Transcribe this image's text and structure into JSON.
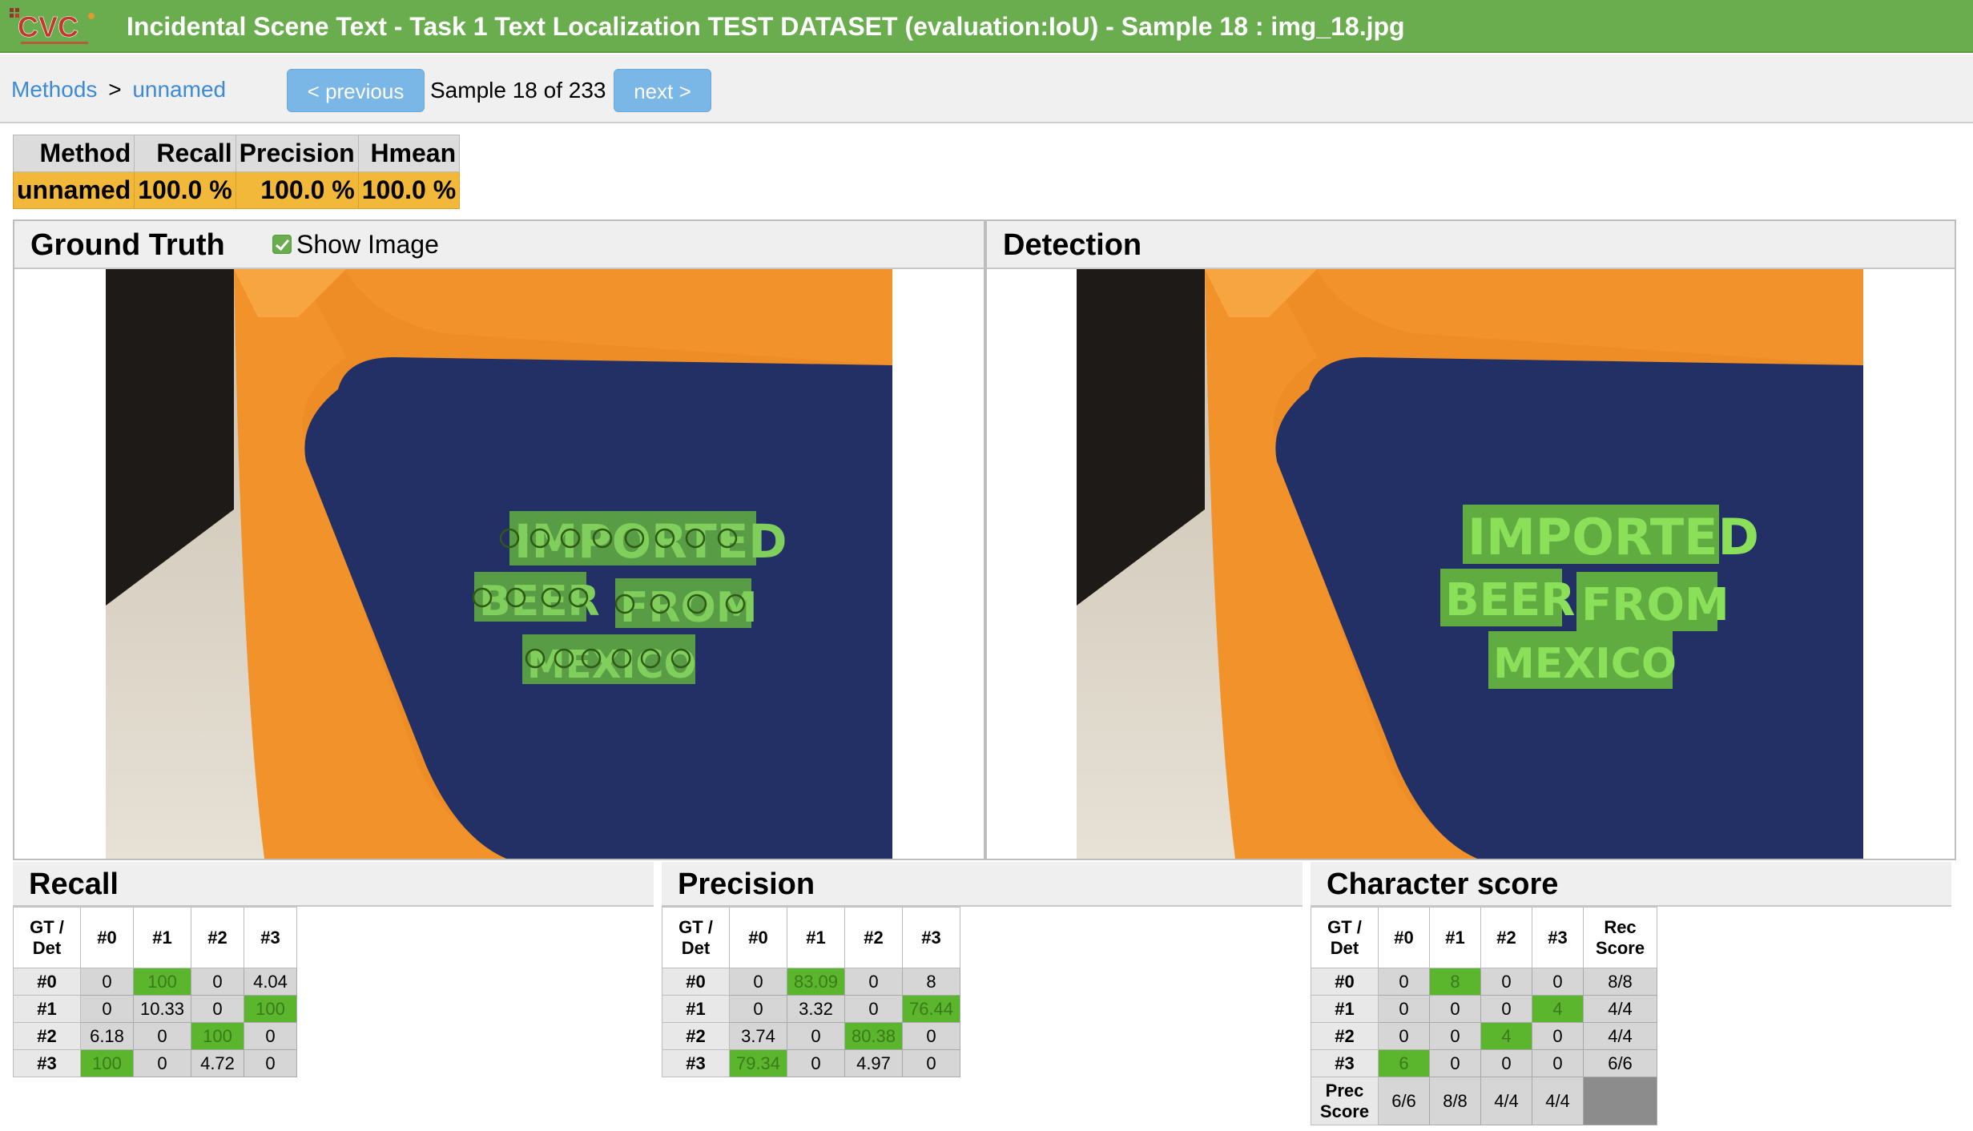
{
  "header": {
    "logo_text": "CVC",
    "title": "Incidental Scene Text - Task 1 Text Localization TEST DATASET (evaluation:IoU) - Sample 18 : img_18.jpg",
    "colors": {
      "bar": "#6aad4f",
      "button": "#7ab6e6",
      "link": "#3d8bd7",
      "highlight": "#f2b83a",
      "match": "#5bb52d"
    }
  },
  "nav": {
    "methods_label": "Methods",
    "separator": ">",
    "method_name": "unnamed",
    "previous_label": "< previous",
    "sample_text": "Sample 18 of 233",
    "next_label": "next >"
  },
  "summary": {
    "headers": [
      "Method",
      "Recall",
      "Precision",
      "Hmean"
    ],
    "row": [
      "unnamed",
      "100.0 %",
      "100.0 %",
      "100.0 %"
    ]
  },
  "panels": {
    "gt_title": "Ground Truth",
    "show_image_label": "Show Image",
    "show_image_checked": true,
    "det_title": "Detection",
    "scene_words": [
      "IMPORTED",
      "BEER",
      "FROM",
      "MEXICO"
    ]
  },
  "recall": {
    "title": "Recall",
    "corner_line1": "GT /",
    "corner_line2": "Det",
    "cols": [
      "#0",
      "#1",
      "#2",
      "#3"
    ],
    "rows": [
      {
        "label": "#0",
        "cells": [
          "0",
          "100",
          "0",
          "4.04"
        ]
      },
      {
        "label": "#1",
        "cells": [
          "0",
          "10.33",
          "0",
          "100"
        ]
      },
      {
        "label": "#2",
        "cells": [
          "6.18",
          "0",
          "100",
          "0"
        ]
      },
      {
        "label": "#3",
        "cells": [
          "100",
          "0",
          "4.72",
          "0"
        ]
      }
    ]
  },
  "precision": {
    "title": "Precision",
    "corner_line1": "GT /",
    "corner_line2": "Det",
    "cols": [
      "#0",
      "#1",
      "#2",
      "#3"
    ],
    "rows": [
      {
        "label": "#0",
        "cells": [
          "0",
          "83.09",
          "0",
          "8"
        ]
      },
      {
        "label": "#1",
        "cells": [
          "0",
          "3.32",
          "0",
          "76.44"
        ]
      },
      {
        "label": "#2",
        "cells": [
          "3.74",
          "0",
          "80.38",
          "0"
        ]
      },
      {
        "label": "#3",
        "cells": [
          "79.34",
          "0",
          "4.97",
          "0"
        ]
      }
    ]
  },
  "character": {
    "title": "Character score",
    "corner_line1": "GT /",
    "corner_line2": "Det",
    "cols": [
      "#0",
      "#1",
      "#2",
      "#3"
    ],
    "rec_line1": "Rec",
    "rec_line2": "Score",
    "rows": [
      {
        "label": "#0",
        "cells": [
          "0",
          "8",
          "0",
          "0"
        ],
        "rec": "8/8"
      },
      {
        "label": "#1",
        "cells": [
          "0",
          "0",
          "0",
          "4"
        ],
        "rec": "4/4"
      },
      {
        "label": "#2",
        "cells": [
          "0",
          "0",
          "4",
          "0"
        ],
        "rec": "4/4"
      },
      {
        "label": "#3",
        "cells": [
          "6",
          "0",
          "0",
          "0"
        ],
        "rec": "6/6"
      }
    ],
    "prec_line1": "Prec",
    "prec_line2": "Score",
    "prec_cells": [
      "6/6",
      "8/8",
      "4/4",
      "4/4"
    ]
  }
}
